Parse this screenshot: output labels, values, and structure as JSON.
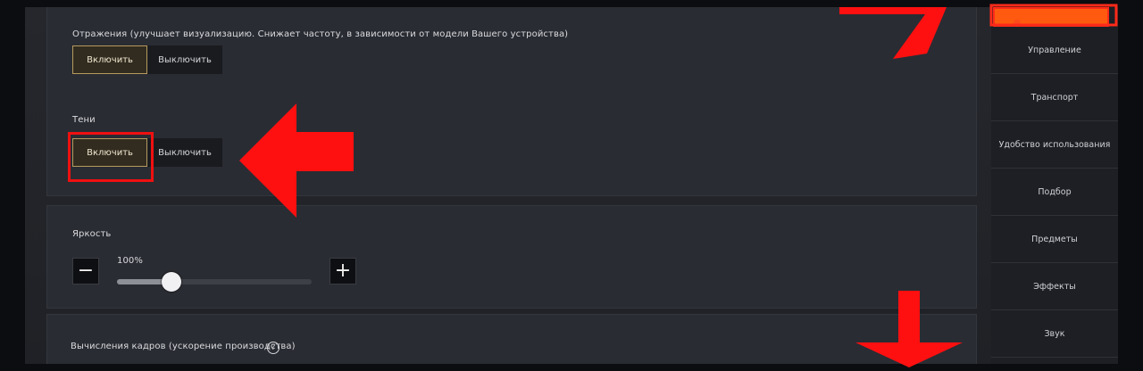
{
  "settings": {
    "section1": {
      "label": "Отражения (улучшает визуализацию. Снижает частоту, в зависимости от модели Вашего устройства)",
      "toggle": {
        "on_label": "Включить",
        "off_label": "Выключить",
        "selected": "on"
      }
    },
    "section2": {
      "label": "Тени",
      "toggle": {
        "on_label": "Включить",
        "off_label": "Выключить",
        "selected": "on"
      }
    },
    "brightness": {
      "label": "Яркость",
      "value_text": "100%",
      "value_fraction": 0.28,
      "minus_label": "−",
      "plus_label": "+"
    },
    "section4": {
      "label": "Вычисления кадров (ускорение производства)",
      "help_label": "?"
    }
  },
  "sidebar": {
    "items": [
      {
        "label": ""
      },
      {
        "label": "Управление"
      },
      {
        "label": "Транспорт"
      },
      {
        "label": "Удобство использования"
      },
      {
        "label": "Подбор"
      },
      {
        "label": "Предметы"
      },
      {
        "label": "Эффекты"
      },
      {
        "label": "Звук"
      }
    ],
    "active_color": "#ff5a0f"
  },
  "annotation_color": "#ff1010"
}
